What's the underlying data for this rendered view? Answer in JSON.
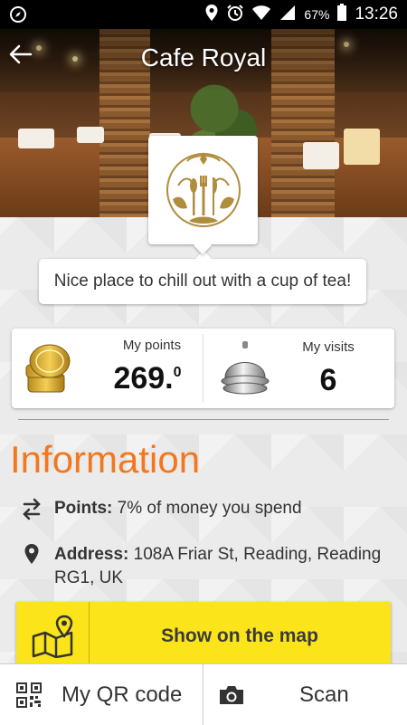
{
  "status_bar": {
    "time": "13:26",
    "battery_percent": "67%",
    "icons": [
      "compass-icon",
      "location-icon",
      "alarm-icon",
      "wifi-icon",
      "signal-icon",
      "battery-icon"
    ]
  },
  "header": {
    "title": "Cafe Royal",
    "back_icon": "arrow-left-icon"
  },
  "venue": {
    "logo_icon": "cafe-logo-icon",
    "tagline": "Nice place to chill out with a cup of tea!"
  },
  "stats": {
    "points_label": "My points",
    "points_whole": "269.",
    "points_fraction": "0",
    "points_icon": "coins-icon",
    "visits_label": "My visits",
    "visits_value": "6",
    "visits_icon": "service-bell-icon"
  },
  "information": {
    "heading": "Information",
    "points_label": "Points:",
    "points_text": " 7% of money you spend",
    "address_label": "Address:",
    "address_text": " 108A Friar St, Reading, Reading RG1, UK"
  },
  "map_button": {
    "label": "Show on the map",
    "icon": "map-pin-icon"
  },
  "bottom_bar": {
    "qr_label": "My QR code",
    "scan_label": "Scan",
    "qr_icon": "qr-code-icon",
    "scan_icon": "camera-icon"
  },
  "colors": {
    "accent_orange": "#f2771e",
    "button_yellow": "#fbe419",
    "status_bar": "#000000"
  }
}
